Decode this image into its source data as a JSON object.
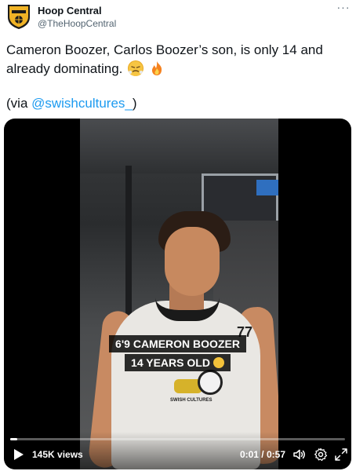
{
  "author": {
    "name": "Hoop Central",
    "handle": "@TheHoopCentral"
  },
  "menu": {
    "more_label": "···"
  },
  "tweet": {
    "text": "Cameron Boozer, Carlos Boozer’s son, is only 14 and already dominating.",
    "emojis": [
      "face-with-steam-from-nose",
      "fire"
    ],
    "via_prefix": "(via ",
    "via_link": "@swishcultures_",
    "via_suffix": ")"
  },
  "video": {
    "caption_line1": "6'9 CAMERON BOOZER",
    "caption_line2": "14 YEARS OLD",
    "caption_emoji": "screaming-face",
    "jersey_number": "77",
    "jersey_logo_text": "SWISH CULTURES",
    "views": "145K views",
    "time": "0:01 / 0:57",
    "progress_fraction": 0.02,
    "icons": [
      "play-icon",
      "volume-icon",
      "settings-icon",
      "fullscreen-icon"
    ]
  },
  "colors": {
    "link": "#1d9bf0",
    "text": "#0f1419",
    "secondary": "#536471"
  }
}
